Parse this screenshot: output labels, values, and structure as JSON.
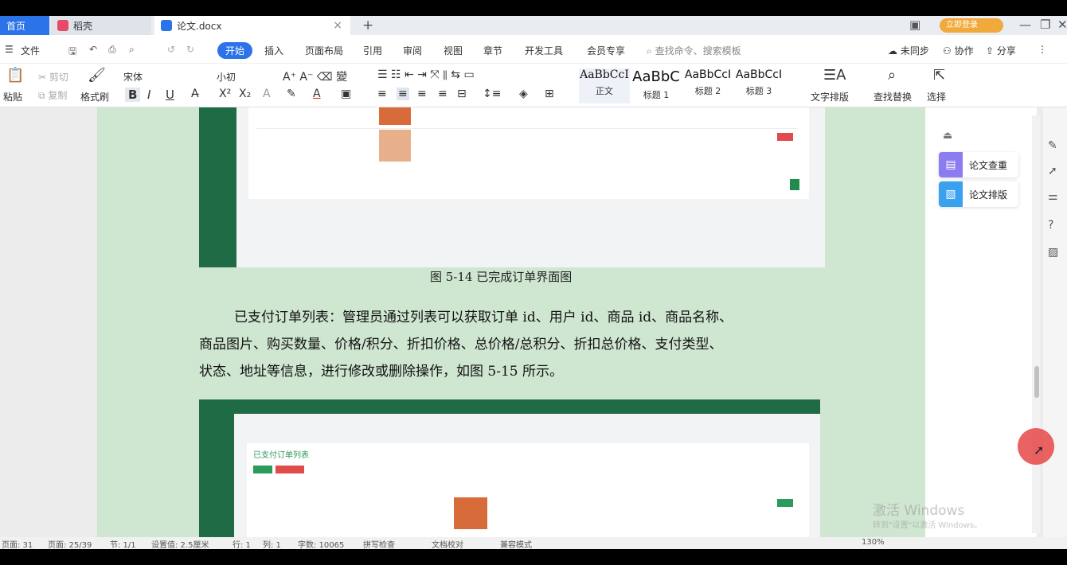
{
  "titlebar": {
    "tabs": [
      {
        "label": "首页"
      },
      {
        "label": "稻壳"
      },
      {
        "label": "论文.docx"
      }
    ],
    "add_tab": "+",
    "login_label": "立即登录"
  },
  "menubar": {
    "file": "文件",
    "items": [
      "开始",
      "插入",
      "页面布局",
      "引用",
      "审阅",
      "视图",
      "章节",
      "开发工具",
      "会员专享"
    ],
    "search_placeholder": "查找命令、搜索模板",
    "sync": "未同步",
    "collab": "协作",
    "share": "分享"
  },
  "ribbon": {
    "paste": "粘贴",
    "cut": "剪切",
    "copy": "复制",
    "format_painter": "格式刷",
    "font_name": "宋体",
    "font_size": "小初",
    "styles": [
      {
        "sample": "AaBbCcI",
        "label": "正文"
      },
      {
        "sample": "AaBbC",
        "label": "标题 1"
      },
      {
        "sample": "AaBbCcI",
        "label": "标题 2"
      },
      {
        "sample": "AaBbCcI",
        "label": "标题 3"
      }
    ],
    "text_layout": "文字排版",
    "find_replace": "查找替换",
    "select": "选择"
  },
  "document": {
    "figure_caption": "图 5-14 已完成订单界面图",
    "paragraph_lines": [
      "已支付订单列表：管理员通过列表可以获取订单 id、用户 id、商品 id、商品名称、",
      "商品图片、购买数量、价格/积分、折扣价格、总价格/总积分、折扣总价格、支付类型、",
      "状态、地址等信息，进行修改或删除操作，如图 5-15 所示。"
    ],
    "screenshot2_title": "已支付订单列表"
  },
  "right_panel": {
    "buttons": [
      {
        "label": "论文查重",
        "color": "#8b7cf0"
      },
      {
        "label": "论文排版",
        "color": "#3aa0f0"
      }
    ]
  },
  "watermark": {
    "line1": "激活 Windows",
    "line2": "转到\"设置\"以激活 Windows。"
  },
  "statusbar": {
    "page": "页面: 31",
    "pages": "页面: 25/39",
    "section": "节: 1/1",
    "setting": "设置值: 2.5厘米",
    "row": "行: 1",
    "col": "列: 1",
    "words": "字数: 10065",
    "spell": "拼写检查",
    "doc_check": "文档校对",
    "compat": "兼容模式",
    "zoom": "130%"
  }
}
